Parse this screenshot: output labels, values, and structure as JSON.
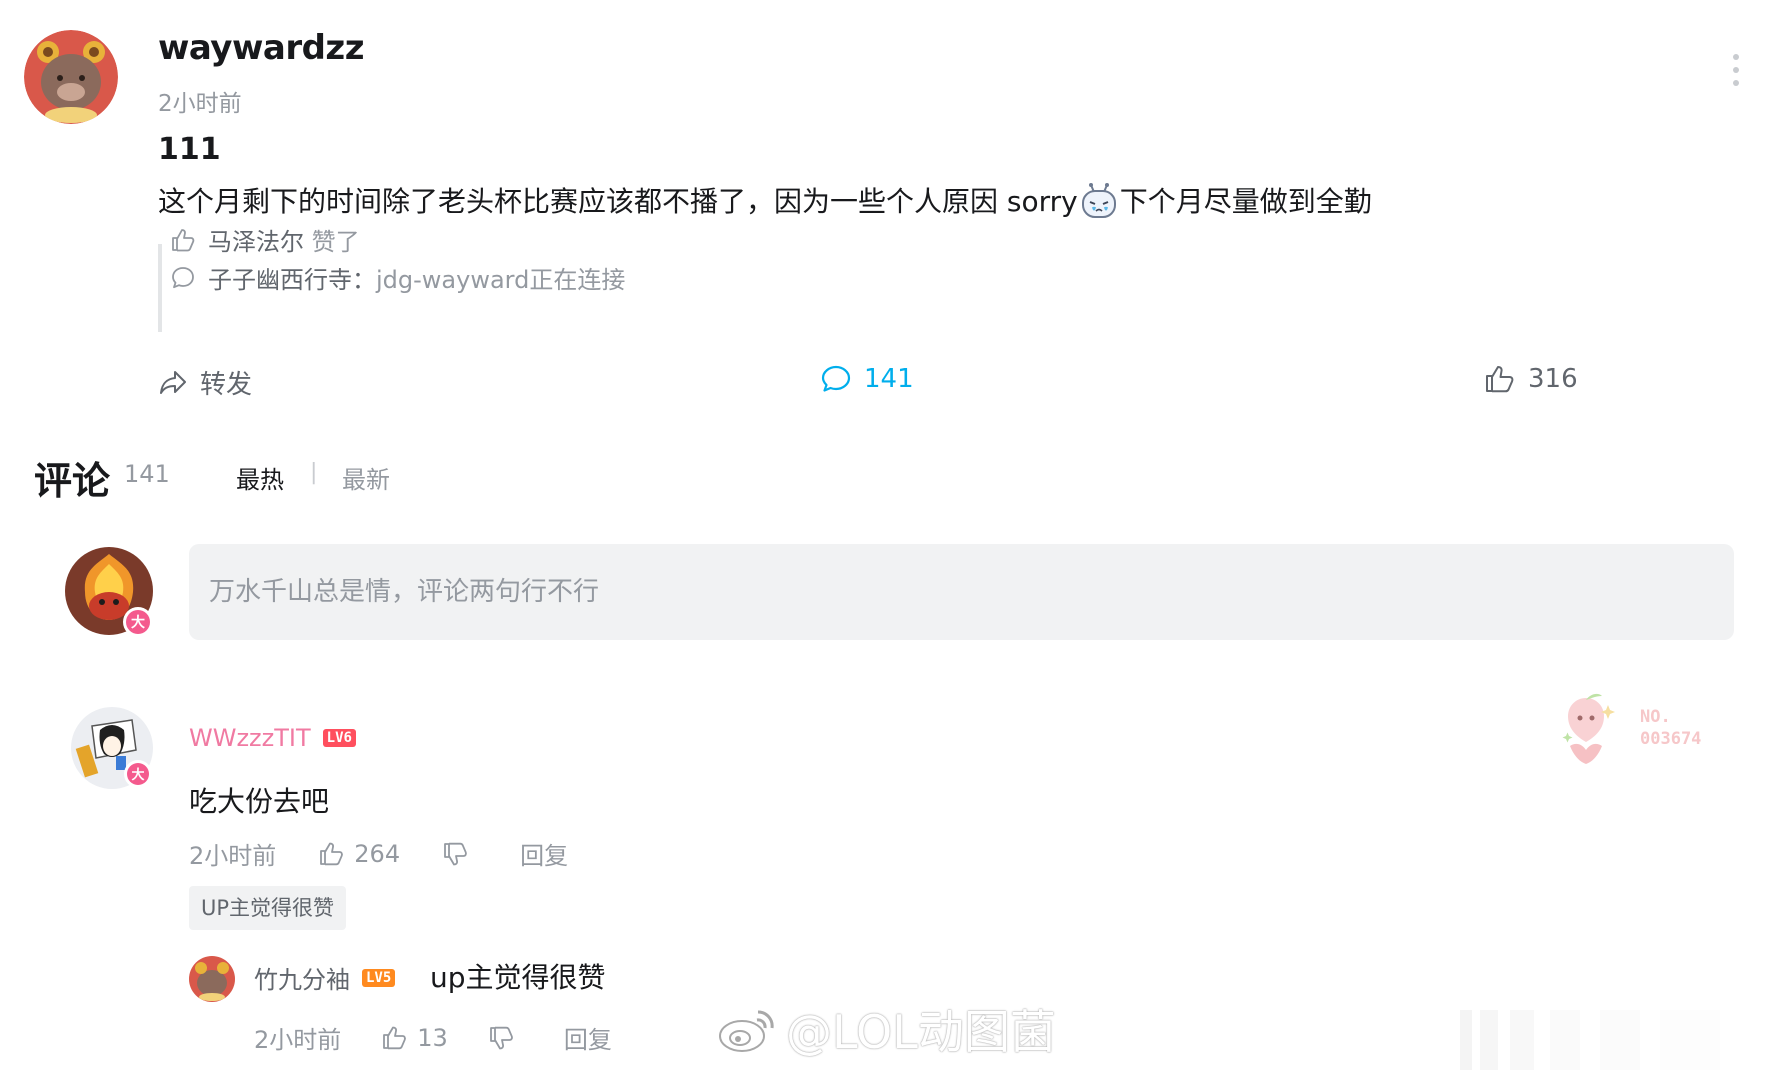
{
  "post": {
    "author": "waywardzz",
    "time": "2小时前",
    "title": "111",
    "body_before_emoji": "这个月剩下的时间除了老头杯比赛应该都不播了，因为一些个人原因 sorry",
    "body_after_emoji": "下个月尽量做到全勤",
    "emoji_icon": "crying-face-emoji"
  },
  "activity": {
    "like_user": "马泽法尔",
    "like_action": "赞了",
    "comment_user": "子子幽西行寺：",
    "comment_text": "jdg-wayward正在连接"
  },
  "actions": {
    "share_label": "转发",
    "comment_count": "141",
    "like_count": "316"
  },
  "comments_header": {
    "title": "评论",
    "count": "141",
    "sort_hot": "最热",
    "separator": "|",
    "sort_new": "最新"
  },
  "comment_input": {
    "placeholder": "万水千山总是情，评论两句行不行",
    "badge": "大"
  },
  "comments": [
    {
      "username": "WWzzzTIT",
      "level": "LV6",
      "avatar_badge": "大",
      "content": "吃大份去吧",
      "time": "2小时前",
      "likes": "264",
      "reply_label": "回复",
      "tag": "UP主觉得很赞",
      "fan_badge": "NO.\n003674",
      "replies": [
        {
          "username": "竹九分袖",
          "level": "LV5",
          "content": "up主觉得很赞",
          "time": "2小时前",
          "likes": "13",
          "reply_label": "回复"
        }
      ]
    }
  ],
  "watermark": {
    "text": "@LOL动图菌"
  },
  "colors": {
    "accent_blue": "#00aeec",
    "username_pink": "#f07aa2",
    "text_primary": "#18191c",
    "text_secondary": "#9499a0",
    "input_bg": "#f1f2f3",
    "level6": "#ff4f5e",
    "level5": "#ff8a1f"
  }
}
